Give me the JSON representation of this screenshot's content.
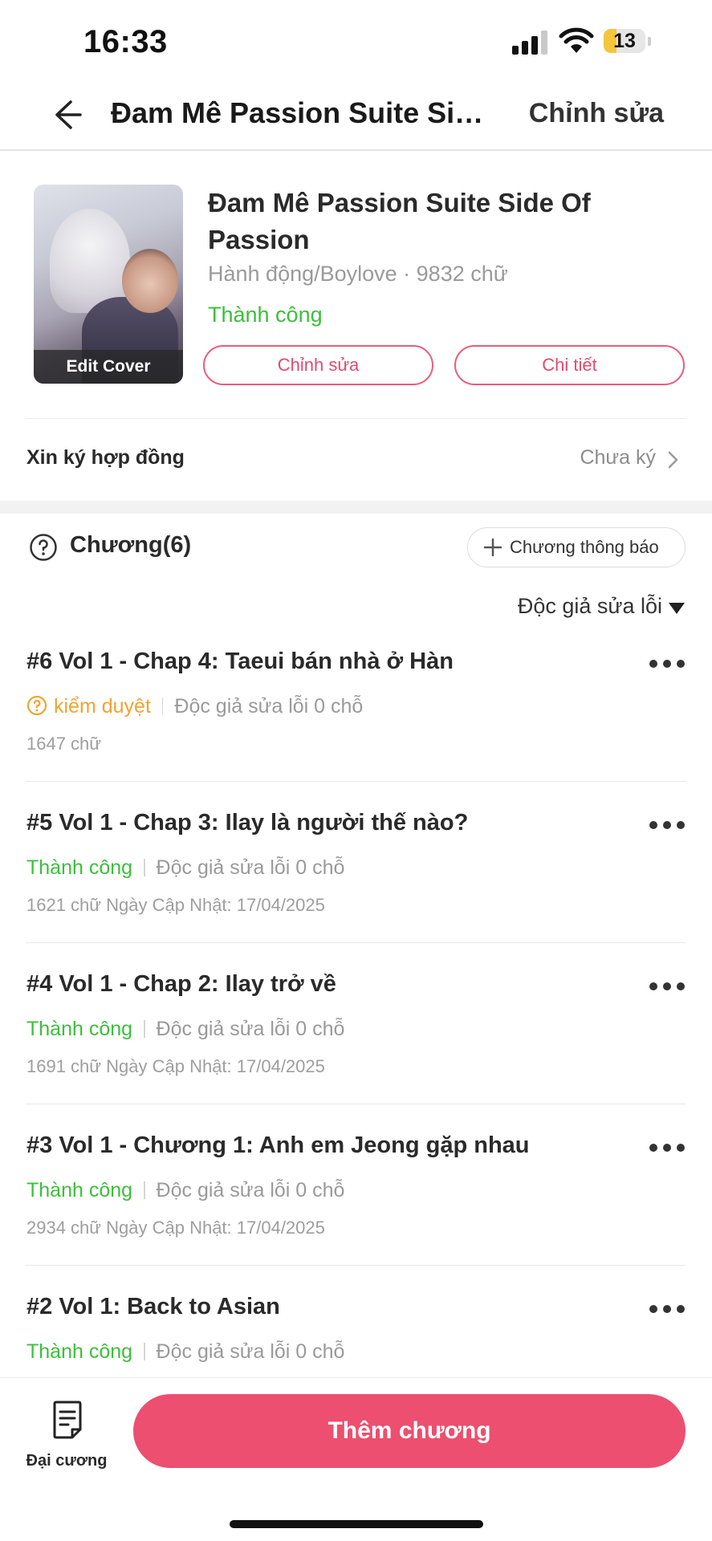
{
  "status_bar": {
    "time": "16:33",
    "battery": "13",
    "battery_level": 0.13
  },
  "nav": {
    "title": "Đam Mê Passion Suite Side...",
    "edit_label": "Chỉnh sửa"
  },
  "book": {
    "cover_label": "Edit Cover",
    "title": "Đam Mê Passion Suite Side Of Passion",
    "meta": "Hành động/Boylove · 9832 chữ",
    "status": "Thành công",
    "edit_button": "Chỉnh sửa",
    "detail_button": "Chi tiết"
  },
  "contract": {
    "label": "Xin ký hợp đồng",
    "value": "Chưa ký"
  },
  "chapters_section": {
    "title": "Chương(6)",
    "announce_button": "Chương thông báo",
    "sort_label": "Độc giả sửa lỗi"
  },
  "chapters": [
    {
      "name": "#6 Vol 1 - Chap 4: Taeui bán nhà ở Hàn",
      "status": "kiểm duyệt",
      "status_type": "pending",
      "fixes": "Độc giả sửa lỗi 0 chỗ",
      "info": "1647 chữ"
    },
    {
      "name": "#5 Vol 1 - Chap 3: Ilay là người thế nào?",
      "status": "Thành công",
      "status_type": "ok",
      "fixes": "Độc giả sửa lỗi 0 chỗ",
      "info": "1621 chữ Ngày Cập Nhật: 17/04/2025"
    },
    {
      "name": "#4 Vol 1 - Chap 2: Ilay trở về",
      "status": "Thành công",
      "status_type": "ok",
      "fixes": "Độc giả sửa lỗi 0 chỗ",
      "info": "1691 chữ Ngày Cập Nhật: 17/04/2025"
    },
    {
      "name": "#3 Vol 1 - Chương 1: Anh em Jeong gặp nhau",
      "status": "Thành công",
      "status_type": "ok",
      "fixes": "Độc giả sửa lỗi 0 chỗ",
      "info": "2934 chữ Ngày Cập Nhật: 17/04/2025"
    },
    {
      "name": "#2 Vol 1: Back to Asian",
      "status": "Thành công",
      "status_type": "ok",
      "fixes": "Độc giả sửa lỗi 0 chỗ",
      "info": ""
    }
  ],
  "bottom_bar": {
    "outline_label": "Đại cương",
    "add_chapter_label": "Thêm chương"
  },
  "colors": {
    "accent": "#ec4f6f",
    "success": "#3cbf3c",
    "pending": "#f1a332"
  },
  "icons": [
    "back-arrow-icon",
    "help-icon",
    "plus-icon",
    "chevron-right-icon",
    "more-icon",
    "outline-document-icon"
  ]
}
